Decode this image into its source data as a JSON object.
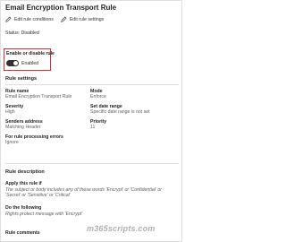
{
  "panel": {
    "title": "Email Encryption Transport Rule"
  },
  "commands": {
    "edit_conditions": "Edit rule conditions",
    "edit_settings": "Edit rule settings"
  },
  "status": "Status: Disabled",
  "toggle": {
    "title": "Enable or disable rule",
    "state": "Enabled",
    "on": true
  },
  "rule_settings": {
    "heading": "Rule settings",
    "rule_name_label": "Rule name",
    "rule_name_value": "Email Encryption Transport Rule",
    "mode_label": "Mode",
    "mode_value": "Enforce",
    "severity_label": "Severity",
    "severity_value": "High",
    "set_date_label": "Set date range",
    "set_date_value": "Specific date range is not set",
    "senders_label": "Senders address",
    "senders_value": "Matching Header",
    "priority_label": "Priority",
    "priority_value": "11",
    "errors_label": "For rule processing errors",
    "errors_value": "Ignore"
  },
  "description": {
    "heading": "Rule description",
    "apply_label": "Apply this rule if",
    "apply_text": "The subject or body includes any of these words 'Encrypt' or 'Confidential' or 'Secret' or 'Sensitive' or 'Critical'",
    "do_label": "Do the following",
    "do_text": "Rights protect message with 'Encrypt'",
    "comments_label": "Rule comments"
  },
  "watermark": "m365scripts.com",
  "colors": {
    "highlight": "#d13438",
    "toggle_on": "#323130"
  }
}
